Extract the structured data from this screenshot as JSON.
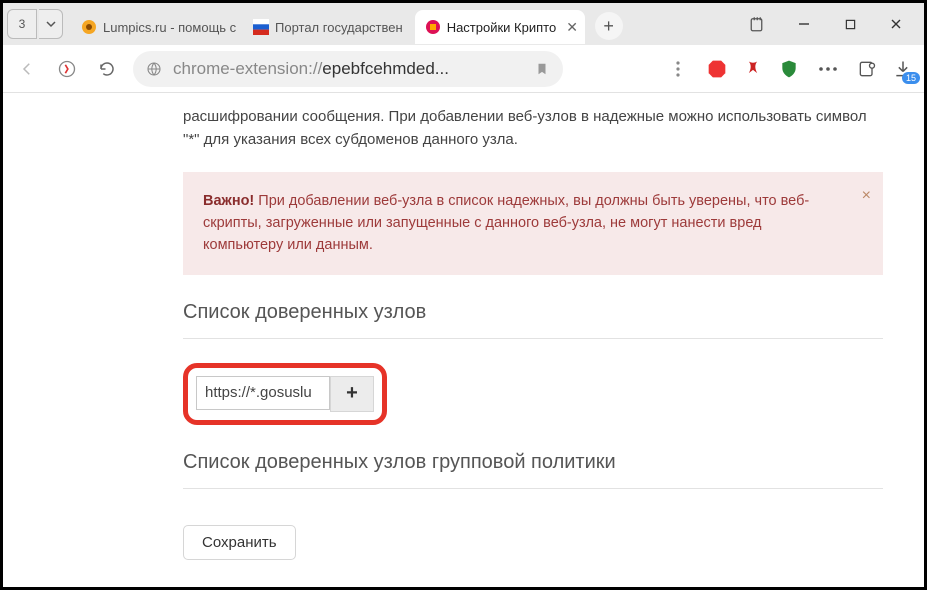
{
  "window": {
    "tabCount": "3",
    "tabs": [
      {
        "label": "Lumpics.ru - помощь с"
      },
      {
        "label": "Портал государствен"
      },
      {
        "label": "Настройки Крипто"
      }
    ]
  },
  "address": {
    "protocol": "chrome-extension://",
    "path": "epebfcehmded..."
  },
  "toolbar": {
    "downloadsBadge": "15"
  },
  "content": {
    "intro": "расшифровании сообщения. При добавлении веб-узлов в надежные можно использовать символ \"*\" для указания всех субдоменов данного узла.",
    "alert_strong": "Важно!",
    "alert_text": " При добавлении веб-узла в список надежных, вы должны быть уверены, что веб-скрипты, загруженные или запущенные с данного веб-узла, не могут нанести вред компьютеру или данным.",
    "section1": "Список доверенных узлов",
    "input_value": "https://*.gosuslu",
    "add_label": "+",
    "section2": "Список доверенных узлов групповой политики",
    "save_label": "Сохранить"
  }
}
